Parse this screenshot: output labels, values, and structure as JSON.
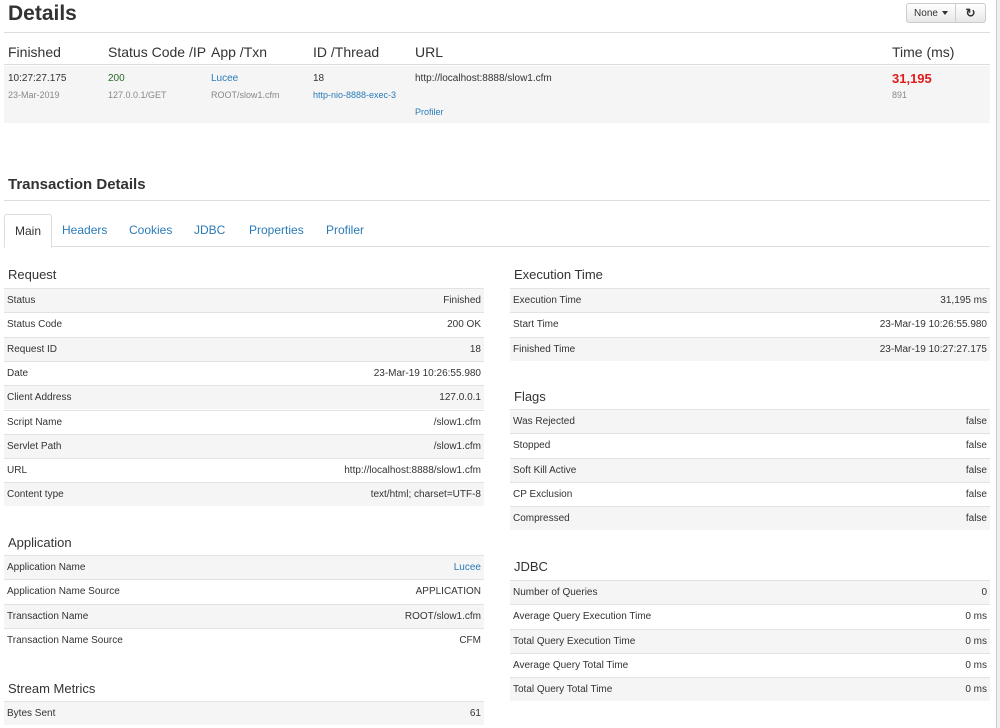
{
  "page_title": "Details",
  "controls": {
    "none_label": "None",
    "refresh_glyph": "↻"
  },
  "summary": {
    "headers": [
      "Finished",
      "Status Code /IP",
      "App /Txn",
      "ID /Thread",
      "URL",
      "Time (ms)"
    ],
    "finished_time": "10:27:27.175",
    "finished_date": "23-Mar-2019",
    "status_code": "200",
    "ip_method": "127.0.0.1/GET",
    "app": "Lucee",
    "txn": "ROOT/slow1.cfm",
    "id": "18",
    "thread": "http-nio-8888-exec-3",
    "url": "http://localhost:8888/slow1.cfm",
    "profiler_link": "Profiler",
    "time_ms": "31,195",
    "time_sub": "891"
  },
  "transaction_title": "Transaction Details",
  "tabs": [
    "Main",
    "Headers",
    "Cookies",
    "JDBC",
    "Properties",
    "Profiler"
  ],
  "request": {
    "title": "Request",
    "rows": [
      {
        "k": "Status",
        "v": "Finished"
      },
      {
        "k": "Status Code",
        "v": "200 OK"
      },
      {
        "k": "Request ID",
        "v": "18"
      },
      {
        "k": "Date",
        "v": "23-Mar-19 10:26:55.980"
      },
      {
        "k": "Client Address",
        "v": "127.0.0.1"
      },
      {
        "k": "Script Name",
        "v": "/slow1.cfm"
      },
      {
        "k": "Servlet Path",
        "v": "/slow1.cfm"
      },
      {
        "k": "URL",
        "v": "http://localhost:8888/slow1.cfm"
      },
      {
        "k": "Content type",
        "v": "text/html; charset=UTF-8"
      }
    ]
  },
  "application": {
    "title": "Application",
    "rows": [
      {
        "k": "Application Name",
        "v": "Lucee"
      },
      {
        "k": "Application Name Source",
        "v": "APPLICATION"
      },
      {
        "k": "Transaction Name",
        "v": "ROOT/slow1.cfm"
      },
      {
        "k": "Transaction Name Source",
        "v": "CFM"
      }
    ]
  },
  "stream": {
    "title": "Stream Metrics",
    "rows": [
      {
        "k": "Bytes Sent",
        "v": "61"
      }
    ]
  },
  "execution": {
    "title": "Execution Time",
    "rows": [
      {
        "k": "Execution Time",
        "v": "31,195 ms"
      },
      {
        "k": "Start Time",
        "v": "23-Mar-19 10:26:55.980"
      },
      {
        "k": "Finished Time",
        "v": "23-Mar-19 10:27:27.175"
      }
    ]
  },
  "flags": {
    "title": "Flags",
    "rows": [
      {
        "k": "Was Rejected",
        "v": "false"
      },
      {
        "k": "Stopped",
        "v": "false"
      },
      {
        "k": "Soft Kill Active",
        "v": "false"
      },
      {
        "k": "CP Exclusion",
        "v": "false"
      },
      {
        "k": "Compressed",
        "v": "false"
      }
    ]
  },
  "jdbc": {
    "title": "JDBC",
    "rows": [
      {
        "k": "Number of Queries",
        "v": "0"
      },
      {
        "k": "Average Query Execution Time",
        "v": "0 ms"
      },
      {
        "k": "Total Query Execution Time",
        "v": "0 ms"
      },
      {
        "k": "Average Query Total Time",
        "v": "0 ms"
      },
      {
        "k": "Total Query Total Time",
        "v": "0 ms"
      }
    ]
  },
  "colors": {
    "link": "#2a7ab8",
    "time_red": "#e21b1b",
    "row_shade": "#f5f5f5"
  }
}
